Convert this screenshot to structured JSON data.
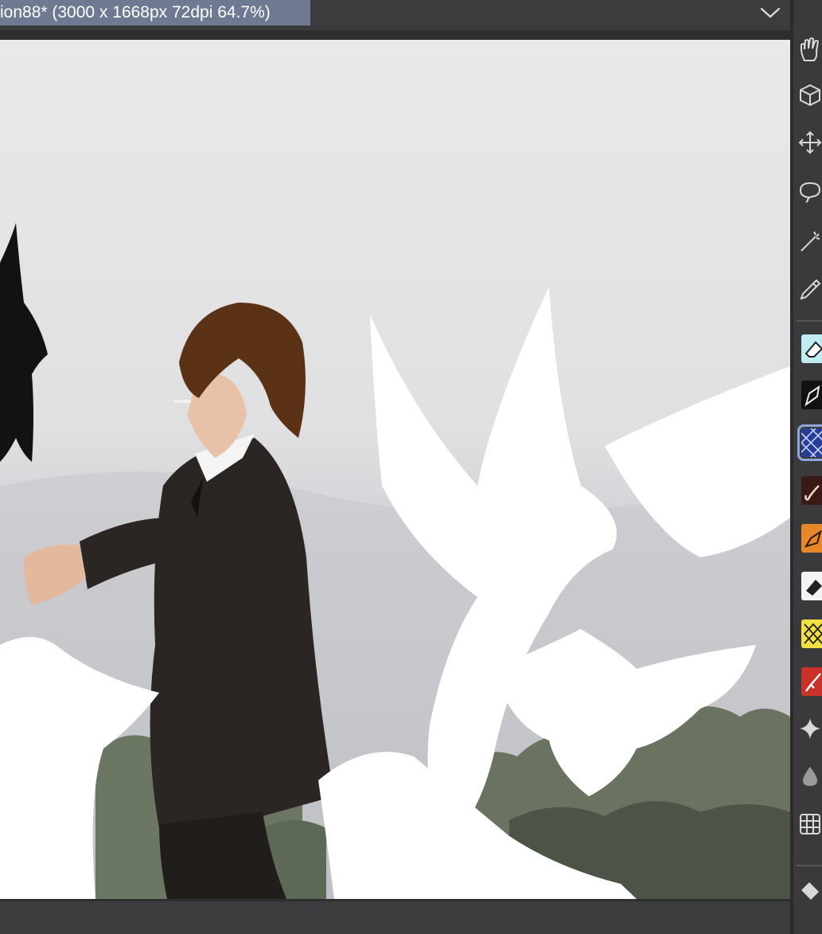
{
  "document_tab": {
    "title": "ion88* (3000 x 1668px 72dpi 64.7%)"
  },
  "toolbar": {
    "tools": [
      {
        "name": "hand-tool",
        "icon": "hand-icon"
      },
      {
        "name": "3d-object-tool",
        "icon": "cube-icon"
      },
      {
        "name": "move-tool",
        "icon": "move-arrows-icon"
      },
      {
        "name": "lasso-tool",
        "icon": "lasso-icon"
      },
      {
        "name": "magic-wand-tool",
        "icon": "magic-wand-icon"
      },
      {
        "name": "eyedropper-tool",
        "icon": "eyedropper-icon"
      }
    ],
    "sub_tools": [
      {
        "name": "eraser-tool",
        "icon": "eraser-icon",
        "color": "#bfeef2"
      },
      {
        "name": "pen-tool",
        "icon": "pen-nib-icon",
        "color": "#111111"
      },
      {
        "name": "pattern-brush-tool",
        "icon": "crosshatch-icon",
        "color": "#263d9a",
        "active": true
      },
      {
        "name": "brush-tool",
        "icon": "brush-icon",
        "color": "#3a1a14"
      },
      {
        "name": "airbrush-tool",
        "icon": "airbrush-icon",
        "color": "#e8862a"
      },
      {
        "name": "decoration-tool",
        "icon": "decoration-icon",
        "color": "#f4f4f4"
      },
      {
        "name": "pattern-tool",
        "icon": "pattern-icon",
        "color": "#f1e041"
      },
      {
        "name": "marker-tool",
        "icon": "marker-icon",
        "color": "#c83228"
      }
    ],
    "bottom_tools": [
      {
        "name": "sparkle-tool",
        "icon": "sparkle-icon"
      },
      {
        "name": "blend-tool",
        "icon": "droplet-icon"
      },
      {
        "name": "grid-tool",
        "icon": "grid-icon"
      },
      {
        "name": "fill-tool",
        "icon": "bucket-icon"
      }
    ]
  },
  "colors": {
    "tab_bg": "#6f7a92",
    "ui_bg": "#3c3c3e",
    "sky_top": "#e9e9ea",
    "sky_bottom": "#c4c5ca",
    "suit": "#2b2623",
    "hair": "#5b3216",
    "trees": "#6c7763"
  }
}
